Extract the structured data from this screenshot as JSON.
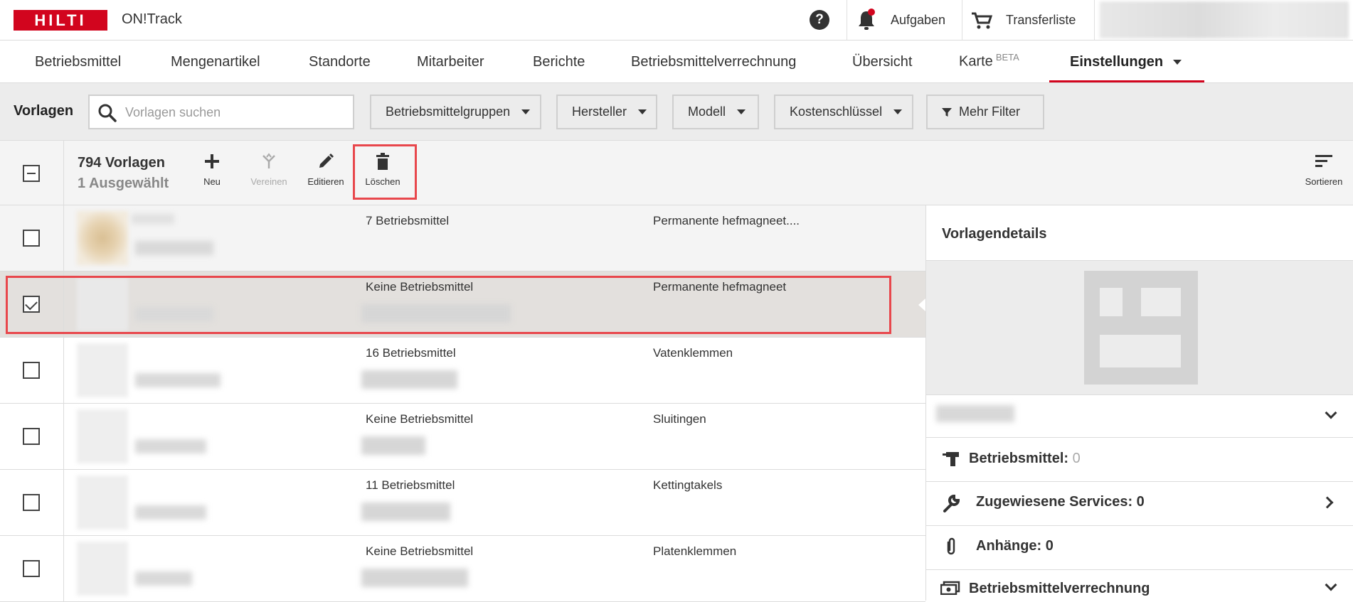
{
  "topbar": {
    "logo_text": "HILTI",
    "app_name": "ON!Track",
    "help_label": "?",
    "tasks_label": "Aufgaben",
    "transfer_label": "Transferliste"
  },
  "nav": {
    "items": [
      {
        "label": "Betriebsmittel"
      },
      {
        "label": "Mengenartikel"
      },
      {
        "label": "Standorte"
      },
      {
        "label": "Mitarbeiter"
      },
      {
        "label": "Berichte"
      },
      {
        "label": "Betriebsmittelverrechnung"
      },
      {
        "label": "Übersicht"
      },
      {
        "label": "Karte",
        "badge": "BETA"
      },
      {
        "label": "Einstellungen"
      }
    ]
  },
  "filters": {
    "title": "Vorlagen",
    "search_placeholder": "Vorlagen suchen",
    "dropdowns": [
      {
        "label": "Betriebsmittelgruppen"
      },
      {
        "label": "Hersteller"
      },
      {
        "label": "Modell"
      },
      {
        "label": "Kostenschlüssel"
      }
    ],
    "more_filters": "Mehr Filter"
  },
  "toolbar": {
    "count": "794 Vorlagen",
    "selected": "1 Ausgewählt",
    "new": "Neu",
    "merge": "Vereinen",
    "edit": "Editieren",
    "delete": "Löschen",
    "sort": "Sortieren"
  },
  "rows": [
    {
      "assets": "7 Betriebsmittel",
      "group": "Permanente hefmagneet....",
      "checked": false
    },
    {
      "assets": "Keine Betriebsmittel",
      "group": "Permanente hefmagneet",
      "checked": true
    },
    {
      "assets": "16 Betriebsmittel",
      "group": "Vatenklemmen",
      "checked": false
    },
    {
      "assets": "Keine Betriebsmittel",
      "group": "Sluitingen",
      "checked": false
    },
    {
      "assets": "11 Betriebsmittel",
      "group": "Kettingtakels",
      "checked": false
    },
    {
      "assets": "Keine Betriebsmittel",
      "group": "Platenklemmen",
      "checked": false
    }
  ],
  "details": {
    "title": "Vorlagendetails",
    "assets_label": "Betriebsmittel:",
    "assets_value": "0",
    "services_label": "Zugewiesene Services: 0",
    "attachments_label": "Anhänge: 0",
    "billing_label": "Betriebsmittelverrechnung"
  },
  "colors": {
    "brand": "#d2051e",
    "highlight": "#e8474c",
    "selected_row": "#e3e0dd"
  }
}
